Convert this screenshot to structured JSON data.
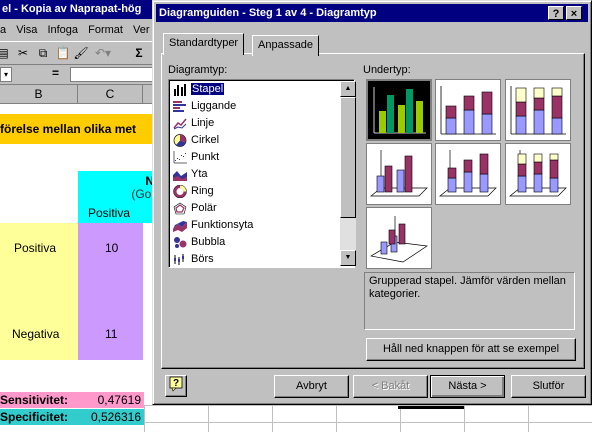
{
  "excel": {
    "title": "el - Kopia av Naprapat-hög",
    "menu": [
      "a",
      "Visa",
      "Infoga",
      "Format",
      "Ver"
    ],
    "col_headers": [
      "B",
      "C"
    ],
    "formula_eq": "=",
    "banner_text": "förelse mellan olika met",
    "header_group_text": "N",
    "header_sub_text": "(Gol",
    "col_label_positiva": "Positiva",
    "row_positiva": {
      "label": "Positiva",
      "value": "10"
    },
    "row_negativa": {
      "label": "Negativa",
      "value": "11"
    },
    "sensitivitet": {
      "label": "Sensitivitet:",
      "value": "0,47619"
    },
    "specificitet": {
      "label": "Specificitet:",
      "value": "0,526316"
    }
  },
  "dialog": {
    "title": "Diagramguiden - Steg 1 av 4 - Diagramtyp",
    "help_btn": "?",
    "close_btn": "×",
    "tabs": [
      "Standardtyper",
      "Anpassade"
    ],
    "diagramtyp_label": "Diagramtyp:",
    "undertyp_label": "Undertyp:",
    "chart_types": [
      {
        "label": "Stapel",
        "icon": "column-chart-icon",
        "selected": true
      },
      {
        "label": "Liggande",
        "icon": "bar-chart-icon"
      },
      {
        "label": "Linje",
        "icon": "line-chart-icon"
      },
      {
        "label": "Cirkel",
        "icon": "pie-chart-icon"
      },
      {
        "label": "Punkt",
        "icon": "scatter-chart-icon"
      },
      {
        "label": "Yta",
        "icon": "area-chart-icon"
      },
      {
        "label": "Ring",
        "icon": "doughnut-chart-icon"
      },
      {
        "label": "Polär",
        "icon": "radar-chart-icon"
      },
      {
        "label": "Funktionsyta",
        "icon": "surface-chart-icon"
      },
      {
        "label": "Bubbla",
        "icon": "bubble-chart-icon"
      },
      {
        "label": "Börs",
        "icon": "stock-chart-icon"
      }
    ],
    "description": "Grupperad stapel. Jämför värden mellan kategorier.",
    "preview_button": "Håll ned knappen för att se exempel",
    "buttons": {
      "cancel": "Avbryt",
      "back": "< Bakåt",
      "next": "Nästa >",
      "finish": "Slutför"
    },
    "colors": {
      "title_bar": "#000080",
      "face": "#c0c0c0",
      "bar_purple": "#993366",
      "bar_blue": "#9999ff",
      "bar_yellow": "#ffffcc",
      "excel_yellow": "#ffff99",
      "excel_cyan": "#00ffff",
      "excel_lavender": "#cc99ff",
      "excel_orange": "#ffcc00",
      "excel_pink": "#ff99cc",
      "excel_teal": "#33cccc"
    }
  }
}
